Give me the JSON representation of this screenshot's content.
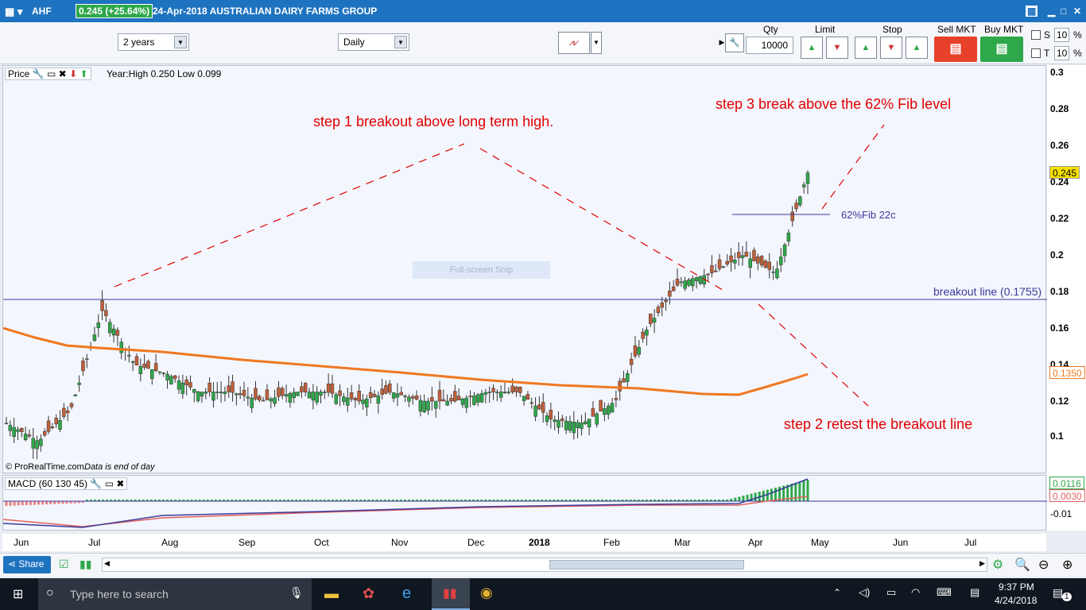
{
  "window": {
    "ticker": "AHF",
    "price_change": "0.245 (+25.64%)",
    "date_title": "24-Apr-2018 AUSTRALIAN DAIRY FARMS GROUP"
  },
  "toolbar": {
    "period": "2 years",
    "interval": "Daily",
    "qty_label": "Qty",
    "qty_value": "10000",
    "limit_label": "Limit",
    "stop_label": "Stop",
    "sell_label": "Sell MKT",
    "buy_label": "Buy MKT",
    "s_label": "S",
    "s_value": "10",
    "t_label": "T",
    "t_value": "10",
    "pct": "%"
  },
  "price_panel": {
    "title": "Price",
    "info": "Year:High 0.250 Low 0.099",
    "footer_brand": "© ProRealTime.com",
    "footer_note": "Data is end of day",
    "snip_watermark": "Full-screen Snip"
  },
  "annotations": {
    "step1": "step 1 breakout above long term high.",
    "step2": "step 2 retest the breakout line",
    "step3": "step 3 break above the 62% Fib level",
    "fib_label": "62%Fib 22c",
    "breakout_label": "breakout line (0.1755)"
  },
  "macd_panel": {
    "title": "MACD (60 130 45)",
    "ticks": [
      "0.0116",
      "0.0030",
      "-0.01"
    ]
  },
  "y_axis": {
    "ticks": [
      "0.3",
      "0.28",
      "0.26",
      "0.24",
      "0.22",
      "0.2",
      "0.18",
      "0.16",
      "0.14",
      "0.12",
      "0.1"
    ],
    "last_price": "0.245",
    "ma_value": "0.1350"
  },
  "x_axis": {
    "ticks": [
      "Jun",
      "Jul",
      "Aug",
      "Sep",
      "Oct",
      "Nov",
      "Dec",
      "2018",
      "Feb",
      "Mar",
      "Apr",
      "May",
      "Jun",
      "Jul"
    ]
  },
  "bottom": {
    "share_label": "Share"
  },
  "taskbar": {
    "search_placeholder": "Type here to search",
    "time": "9:37 PM",
    "date": "4/24/2018",
    "notif_count": "1"
  },
  "colors": {
    "up": "#2ea84a",
    "down": "#c0603a",
    "ma": "#f07820",
    "line": "#3b3b9a",
    "annotation": "#e00000"
  },
  "chart_data": {
    "type": "candlestick",
    "title": "",
    "xlabel": "",
    "ylabel": "",
    "ylim": [
      0.09,
      0.3
    ],
    "x_range": [
      "2017-06",
      "2018-07"
    ],
    "breakout_level": 0.1755,
    "fib_level": 0.222,
    "last_price": 0.245,
    "ma_last": 0.135,
    "series": [
      {
        "name": "price_close_approx",
        "x": [
          "2017-06-01",
          "2017-06-15",
          "2017-06-28",
          "2017-07-03",
          "2017-07-12",
          "2017-07-25",
          "2017-08-10",
          "2017-08-30",
          "2017-09-20",
          "2017-10-10",
          "2017-10-30",
          "2017-11-15",
          "2017-11-30",
          "2017-12-20",
          "2018-01-10",
          "2018-01-25",
          "2018-02-10",
          "2018-02-28",
          "2018-03-12",
          "2018-03-22",
          "2018-03-27",
          "2018-04-03",
          "2018-04-10",
          "2018-04-17",
          "2018-04-20",
          "2018-04-24"
        ],
        "values": [
          0.108,
          0.098,
          0.115,
          0.17,
          0.14,
          0.135,
          0.125,
          0.125,
          0.12,
          0.125,
          0.125,
          0.12,
          0.125,
          0.12,
          0.12,
          0.125,
          0.125,
          0.11,
          0.108,
          0.12,
          0.16,
          0.185,
          0.19,
          0.2,
          0.19,
          0.245
        ]
      },
      {
        "name": "ma_approx",
        "x": [
          "2017-06-01",
          "2017-07-01",
          "2017-08-01",
          "2017-09-01",
          "2017-10-01",
          "2017-11-01",
          "2017-12-01",
          "2018-01-01",
          "2018-02-01",
          "2018-03-01",
          "2018-03-25",
          "2018-04-24"
        ],
        "values": [
          0.16,
          0.149,
          0.148,
          0.144,
          0.139,
          0.136,
          0.133,
          0.131,
          0.128,
          0.124,
          0.123,
          0.135
        ]
      }
    ]
  }
}
